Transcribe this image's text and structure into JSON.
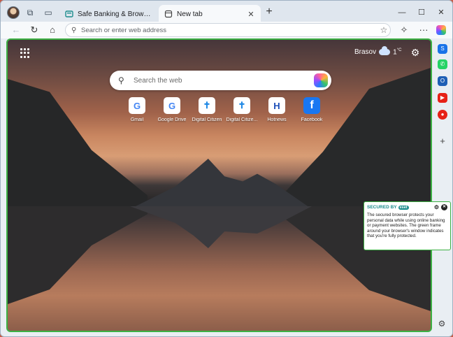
{
  "tabs": [
    {
      "title": "Safe Banking & Browsing | ESET S",
      "active": false
    },
    {
      "title": "New tab",
      "active": true
    }
  ],
  "address_bar": {
    "placeholder": "Search or enter web address"
  },
  "newtab": {
    "weather": {
      "city": "Brasov",
      "temp": "1",
      "unit": "°C"
    },
    "search_placeholder": "Search the web",
    "quick_links": [
      {
        "label": "Gmail",
        "icon": "google-icon",
        "glyph": "G",
        "color": "#4285f4"
      },
      {
        "label": "Google Drive",
        "icon": "google-icon",
        "glyph": "G",
        "color": "#4285f4"
      },
      {
        "label": "Digital Citizen",
        "icon": "digital-citizen-icon",
        "glyph": "✝",
        "color": "#1e88e5"
      },
      {
        "label": "Digital Citize...",
        "icon": "digital-citizen-icon",
        "glyph": "✝",
        "color": "#1e88e5"
      },
      {
        "label": "Hotnews",
        "icon": "hotnews-icon",
        "glyph": "H",
        "color": "#1b4db8"
      },
      {
        "label": "Facebook",
        "icon": "facebook-icon",
        "glyph": "f",
        "color": "#1877f2"
      }
    ]
  },
  "eset_popup": {
    "secured_by": "SECURED BY",
    "brand": "eset",
    "message": "The secured browser protects your personal data while using online banking or payment websites. The green frame around your browser's window indicates that you're fully protected."
  },
  "colors": {
    "secure_frame": "#3cb043",
    "eset_teal": "#1a8c8c"
  }
}
